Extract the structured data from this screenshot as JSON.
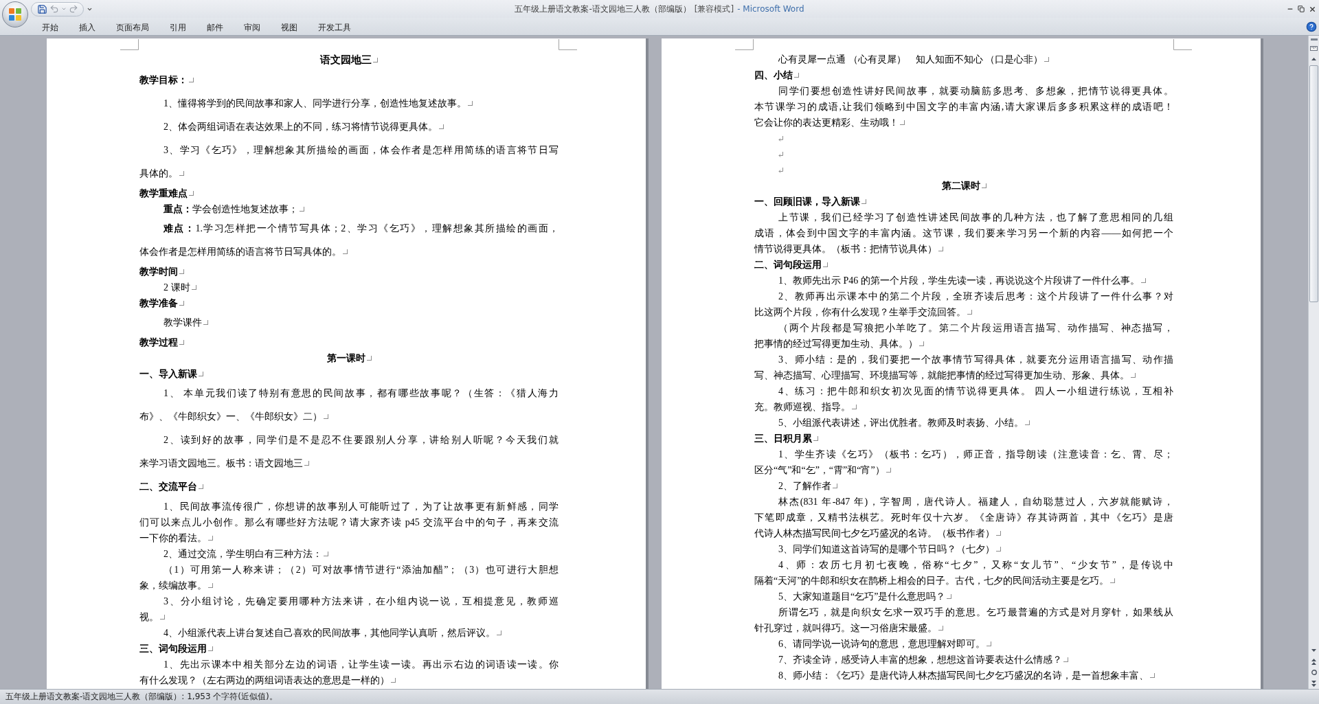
{
  "window": {
    "title": "五年级上册语文教案-语文园地三人教（部编版）",
    "mode": "[兼容模式]",
    "app": "- Microsoft Word"
  },
  "ribbon_tabs": [
    {
      "label": "开始",
      "selected": false
    },
    {
      "label": "插入",
      "selected": false
    },
    {
      "label": "页面布局",
      "selected": false
    },
    {
      "label": "引用",
      "selected": false
    },
    {
      "label": "邮件",
      "selected": false
    },
    {
      "label": "审阅",
      "selected": false
    },
    {
      "label": "视图",
      "selected": false
    },
    {
      "label": "开发工具",
      "selected": false
    }
  ],
  "pages": [
    {
      "paragraphs": [
        {
          "kind": "title",
          "lines": [
            "语文园地三"
          ]
        },
        {
          "kind": "spaced_heading",
          "lines": [
            "教学目标："
          ]
        },
        {
          "kind": "spaced_text",
          "lines": [
            "1、懂得将学到的民间故事和家人、同学进行分享，创造性地复述故事。"
          ]
        },
        {
          "kind": "spaced_text",
          "lines": [
            "2、体会两组词语在表达效果上的不同，练习将情节说得更具体。"
          ]
        },
        {
          "kind": "spaced_text",
          "lines": [
            "3、学习《乞巧》，理解想象其所描绘的画面，体会作者是怎样用简练的语言将节日写",
            "具体的。"
          ]
        },
        {
          "kind": "heading",
          "lines": [
            "教学重难点"
          ]
        },
        {
          "kind": "text",
          "lines": [
            "**重点：**学会创造性地复述故事；"
          ]
        },
        {
          "kind": "spaced_text",
          "lines": [
            "**难点：**1.学习怎样把一个情节写具体；2、学习《乞巧》，理解想象其所描绘的画面，",
            "体会作者是怎样用简练的语言将节日写具体的。"
          ]
        },
        {
          "kind": "heading",
          "lines": [
            "教学时间"
          ]
        },
        {
          "kind": "text",
          "lines": [
            "2 课时"
          ]
        },
        {
          "kind": "heading",
          "lines": [
            "教学准备"
          ]
        },
        {
          "kind": "spaced_text",
          "lines": [
            "教学课件"
          ]
        },
        {
          "kind": "heading",
          "lines": [
            "教学过程"
          ]
        },
        {
          "kind": "lesson",
          "lines": [
            "第一课时"
          ]
        },
        {
          "kind": "heading",
          "lines": [
            "一、导入新课"
          ]
        },
        {
          "kind": "spaced_text",
          "lines": [
            "1、 本单元我们读了特别有意思的民间故事，都有哪些故事呢？（生答：《猎人海力",
            "布》、《牛郎织女》一、《牛郎织女》二）"
          ]
        },
        {
          "kind": "spaced_text",
          "lines": [
            "2、读到好的故事，同学们是不是忍不住要跟别人分享，讲给别人听呢？今天我们就",
            "来学习语文园地三。板书：语文园地三"
          ]
        },
        {
          "kind": "spaced_heading",
          "lines": [
            "二、交流平台"
          ]
        },
        {
          "kind": "text",
          "lines": [
            "1、民间故事流传很广，你想讲的故事别人可能听过了，为了让故事更有新鲜感，同学",
            "们可以来点儿小创作。那么有哪些好方法呢？请大家齐读 p45 交流平台中的句子，再来交流",
            "一下你的看法。"
          ]
        },
        {
          "kind": "text",
          "lines": [
            "2、通过交流，学生明白有三种方法："
          ]
        },
        {
          "kind": "text",
          "lines": [
            "（1）可用第一人称来讲；（2）可对故事情节进行“添油加醋”；（3）也可进行大胆想",
            "象，续编故事。"
          ]
        },
        {
          "kind": "text",
          "lines": [
            "3、分小组讨论，先确定要用哪种方法来讲，在小组内说一说，互相提意见，教师巡",
            "视。"
          ]
        },
        {
          "kind": "text",
          "lines": [
            "4、小组派代表上讲台复述自己喜欢的民间故事，其他同学认真听，然后评议。"
          ]
        },
        {
          "kind": "heading",
          "lines": [
            "三、词句段运用"
          ]
        },
        {
          "kind": "text",
          "lines": [
            "1、先出示课本中相关部分左边的词语，让学生读一读。再出示右边的词语读一读。你",
            "有什么发现？（左右两边的两组词语表达的意思是一样的）"
          ]
        }
      ]
    },
    {
      "paragraphs": [
        {
          "kind": "text",
          "lines": [
            "心有灵犀一点通 （心有灵犀）    知人知面不知心 （口是心非）"
          ]
        },
        {
          "kind": "heading",
          "lines": [
            "四、小结"
          ]
        },
        {
          "kind": "text",
          "lines": [
            "同学们要想创造性讲好民间故事，就要动脑筋多思考、多想象，把情节说得更具体。",
            "本节课学习的成语,让我们领略到中国文字的丰富内涵,请大家课后多多积累这样的成语吧！",
            "它会让你的表达更精彩、生动哦！"
          ]
        },
        {
          "kind": "blank"
        },
        {
          "kind": "blank"
        },
        {
          "kind": "blank"
        },
        {
          "kind": "lesson",
          "lines": [
            "第二课时"
          ]
        },
        {
          "kind": "heading",
          "lines": [
            "一、回顾旧课，导入新课"
          ]
        },
        {
          "kind": "text",
          "lines": [
            "上节课，我们已经学习了创造性讲述民间故事的几种方法，也了解了意思相同的几组",
            "成语，体会到中国文字的丰富内涵。这节课，我们要来学习另一个新的内容——如何把一个",
            "情节说得更具体。（板书：把情节说具体）"
          ]
        },
        {
          "kind": "heading",
          "lines": [
            "二、词句段运用"
          ]
        },
        {
          "kind": "text",
          "lines": [
            "1、教师先出示 P46 的第一个片段，学生先读一读，再说说这个片段讲了一件什么事。"
          ]
        },
        {
          "kind": "text",
          "lines": [
            "2、教师再出示课本中的第二个片段，全班齐读后思考：这个片段讲了一件什么事？对",
            "比这两个片段，你有什么发现？生举手交流回答。"
          ]
        },
        {
          "kind": "text",
          "lines": [
            "（两个片段都是写狼把小羊吃了。第二个片段运用语言描写、动作描写、神态描写，",
            "把事情的经过写得更加生动、具体。）"
          ]
        },
        {
          "kind": "text",
          "lines": [
            "3、师小结：是的，我们要把一个故事情节写得具体，就要充分运用语言描写、动作描",
            "写、神态描写、心理描写、环境描写等，就能把事情的经过写得更加生动、形象、具体。"
          ]
        },
        {
          "kind": "text",
          "lines": [
            "4、练习：把牛郎和织女初次见面的情节说得更具体。 四人一小组进行练说，互相补",
            "充。教师巡视、指导。"
          ]
        },
        {
          "kind": "text",
          "lines": [
            "5、小组派代表讲述，评出优胜者。教师及时表扬、小结。"
          ]
        },
        {
          "kind": "heading",
          "lines": [
            "三、日积月累"
          ]
        },
        {
          "kind": "text",
          "lines": [
            "1、学生齐读《乞巧》（板书：乞巧），师正音，指导朗读（注意读音：乞、霄、尽；",
            "区分“气”和“乞”，“霄”和“宵”）"
          ]
        },
        {
          "kind": "text",
          "lines": [
            "2、了解作者"
          ]
        },
        {
          "kind": "text",
          "lines": [
            "林杰(831 年-847 年)，字智周，唐代诗人。福建人，自幼聪慧过人，六岁就能赋诗，",
            "下笔即成章，又精书法棋艺。死时年仅十六岁。《全唐诗》存其诗两首，其中《乞巧》是唐",
            "代诗人林杰描写民间七夕乞巧盛况的名诗。（板书作者）"
          ]
        },
        {
          "kind": "text",
          "lines": [
            "3、同学们知道这首诗写的是哪个节日吗？（七夕）"
          ]
        },
        {
          "kind": "text",
          "lines": [
            "4、师：农历七月初七夜晚，俗称“七夕”，又称“女儿节”、“少女节”，是传说中",
            "隔着“天河”的牛郎和织女在鹊桥上相会的日子。古代，七夕的民间活动主要是乞巧。"
          ]
        },
        {
          "kind": "text",
          "lines": [
            "5、大家知道题目“乞巧”是什么意思吗？"
          ]
        },
        {
          "kind": "text",
          "lines": [
            "所谓乞巧，就是向织女乞求一双巧手的意思。乞巧最普遍的方式是对月穿针，如果线从",
            "针孔穿过，就叫得巧。这一习俗唐宋最盛。"
          ]
        },
        {
          "kind": "text",
          "lines": [
            "6、请同学说一说诗句的意思，意思理解对即可。"
          ]
        },
        {
          "kind": "text",
          "lines": [
            "7、齐读全诗，感受诗人丰富的想象，想想这首诗要表达什么情感？"
          ]
        },
        {
          "kind": "text",
          "lines": [
            "8、师小结：《乞巧》是唐代诗人林杰描写民间七夕乞巧盛况的名诗，是一首想象丰富、"
          ]
        }
      ]
    }
  ],
  "status_bar": {
    "text": "五年级上册语文教案-语文园地三人教（部编版）: 1,953 个字符(近似值)。"
  }
}
